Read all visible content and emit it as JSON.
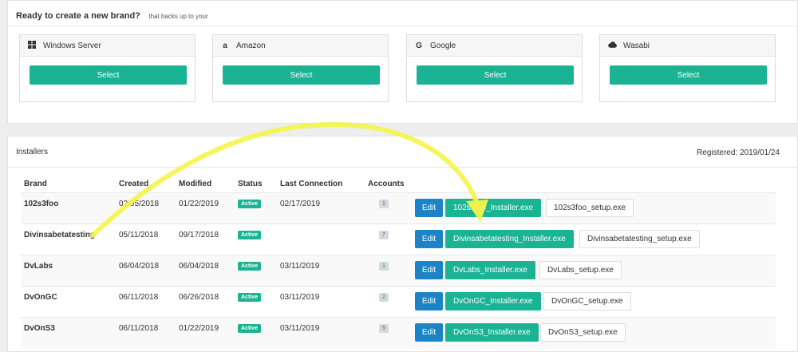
{
  "header": {
    "title": "Ready to create a new brand?",
    "subtitle": "that backs up to your"
  },
  "providers": [
    {
      "name": "Windows Server",
      "icon": "windows-icon",
      "button": "Select"
    },
    {
      "name": "Amazon",
      "icon": "amazon-icon",
      "button": "Select"
    },
    {
      "name": "Google",
      "icon": "google-icon",
      "button": "Select"
    },
    {
      "name": "Wasabi",
      "icon": "cloud-icon",
      "button": "Select"
    }
  ],
  "installers": {
    "title": "Installers",
    "registered": "Registered: 2019/01/24",
    "columns": [
      "Brand",
      "Created",
      "Modified",
      "Status",
      "Last Connection",
      "Accounts"
    ],
    "rows": [
      {
        "brand": "102s3foo",
        "created": "02/05/2018",
        "modified": "01/22/2019",
        "status": "Active",
        "last": "02/17/2019",
        "accounts": "1",
        "edit": "Edit",
        "installer": "102s3foo_Installer.exe",
        "setup": "102s3foo_setup.exe"
      },
      {
        "brand": "Divinsabetatesting",
        "created": "05/11/2018",
        "modified": "09/17/2018",
        "status": "Active",
        "last": "",
        "accounts": "7",
        "edit": "Edit",
        "installer": "Divinsabetatesting_Installer.exe",
        "setup": "Divinsabetatesting_setup.exe"
      },
      {
        "brand": "DvLabs",
        "created": "06/04/2018",
        "modified": "06/04/2018",
        "status": "Active",
        "last": "03/11/2019",
        "accounts": "1",
        "edit": "Edit",
        "installer": "DvLabs_Installer.exe",
        "setup": "DvLabs_setup.exe"
      },
      {
        "brand": "DvOnGC",
        "created": "06/11/2018",
        "modified": "06/26/2018",
        "status": "Active",
        "last": "03/11/2019",
        "accounts": "2",
        "edit": "Edit",
        "installer": "DvOnGC_Installer.exe",
        "setup": "DvOnGC_setup.exe"
      },
      {
        "brand": "DvOnS3",
        "created": "06/11/2018",
        "modified": "01/22/2019",
        "status": "Active",
        "last": "03/11/2019",
        "accounts": "5",
        "edit": "Edit",
        "installer": "DvOnS3_Installer.exe",
        "setup": "DvOnS3_setup.exe"
      }
    ]
  },
  "colors": {
    "primary_green": "#1ab394",
    "edit_blue": "#1c84c6",
    "annotation_arrow": "#f5f542"
  }
}
